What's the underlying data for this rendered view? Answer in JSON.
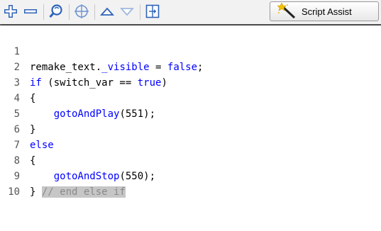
{
  "toolbar": {
    "buttons": [
      {
        "name": "add-statement",
        "icon": "plus-cross-icon"
      },
      {
        "name": "delete-statement",
        "icon": "minus-icon"
      },
      {
        "name": "find",
        "icon": "magnifier-icon"
      },
      {
        "name": "insert-target-path",
        "icon": "crosshair-icon"
      },
      {
        "name": "move-up",
        "icon": "triangle-up-icon"
      },
      {
        "name": "move-down",
        "icon": "triangle-down-icon"
      },
      {
        "name": "show-code-hint",
        "icon": "code-hint-icon"
      }
    ],
    "script_assist_label": "Script Assist",
    "script_assist_icon": "magic-wand-icon"
  },
  "code": {
    "lines": [
      {
        "num": "1"
      },
      {
        "num": "2"
      },
      {
        "num": "3"
      },
      {
        "num": "4"
      },
      {
        "num": "5"
      },
      {
        "num": "6"
      },
      {
        "num": "7"
      },
      {
        "num": "8"
      },
      {
        "num": "9"
      },
      {
        "num": "10"
      }
    ],
    "tokens": {
      "l1_a": "remake_text.",
      "l1_b": "_visible",
      "l1_c": " = ",
      "l1_d": "false",
      "l1_e": ";",
      "l2_a": "if",
      "l2_b": " (switch_var == ",
      "l2_c": "true",
      "l2_d": ")",
      "l3": "{",
      "l4_a": "    ",
      "l4_b": "gotoAndPlay",
      "l4_c": "(551);",
      "l5": "}",
      "l6": "else",
      "l7": "{",
      "l8_a": "    ",
      "l8_b": "gotoAndStop",
      "l8_c": "(550);",
      "l9_a": "} ",
      "l9_b": "// end else if"
    }
  },
  "colors": {
    "keyword": "#0000ff",
    "comment_bg": "#c6c6c6",
    "comment_fg": "#8a8a8a"
  }
}
